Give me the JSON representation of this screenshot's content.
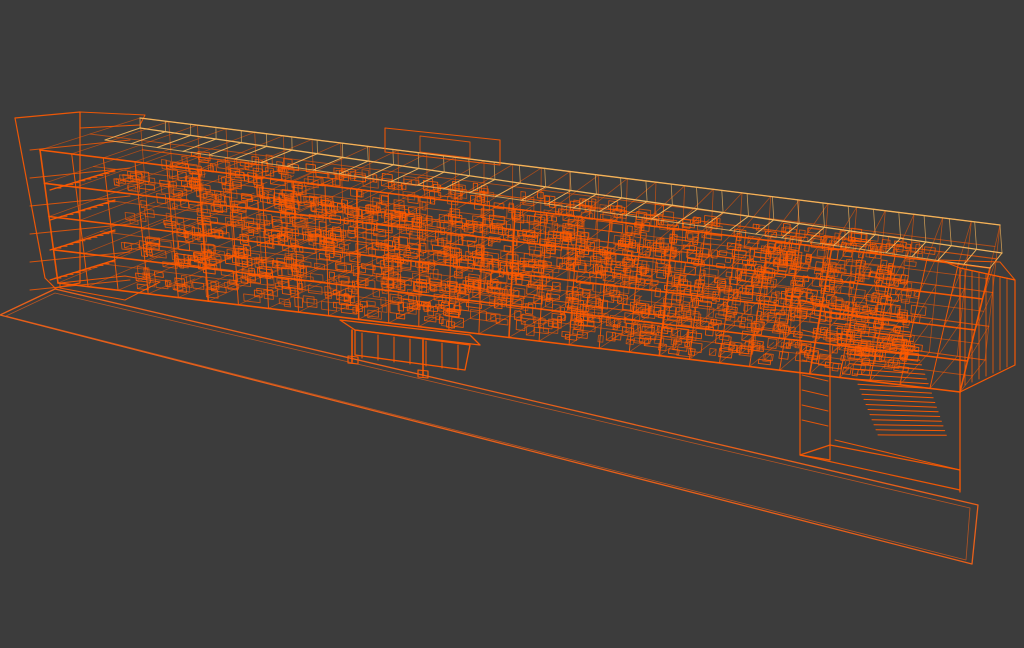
{
  "viewport": {
    "background_color": "#3c3c3c",
    "render_mode": "wireframe"
  },
  "model": {
    "wire_color": "#ff5a00",
    "roof_rail_color": "#f2b35a",
    "ground_plane_color": "#e8601a",
    "levels": 4,
    "roof_bays": 34
  }
}
